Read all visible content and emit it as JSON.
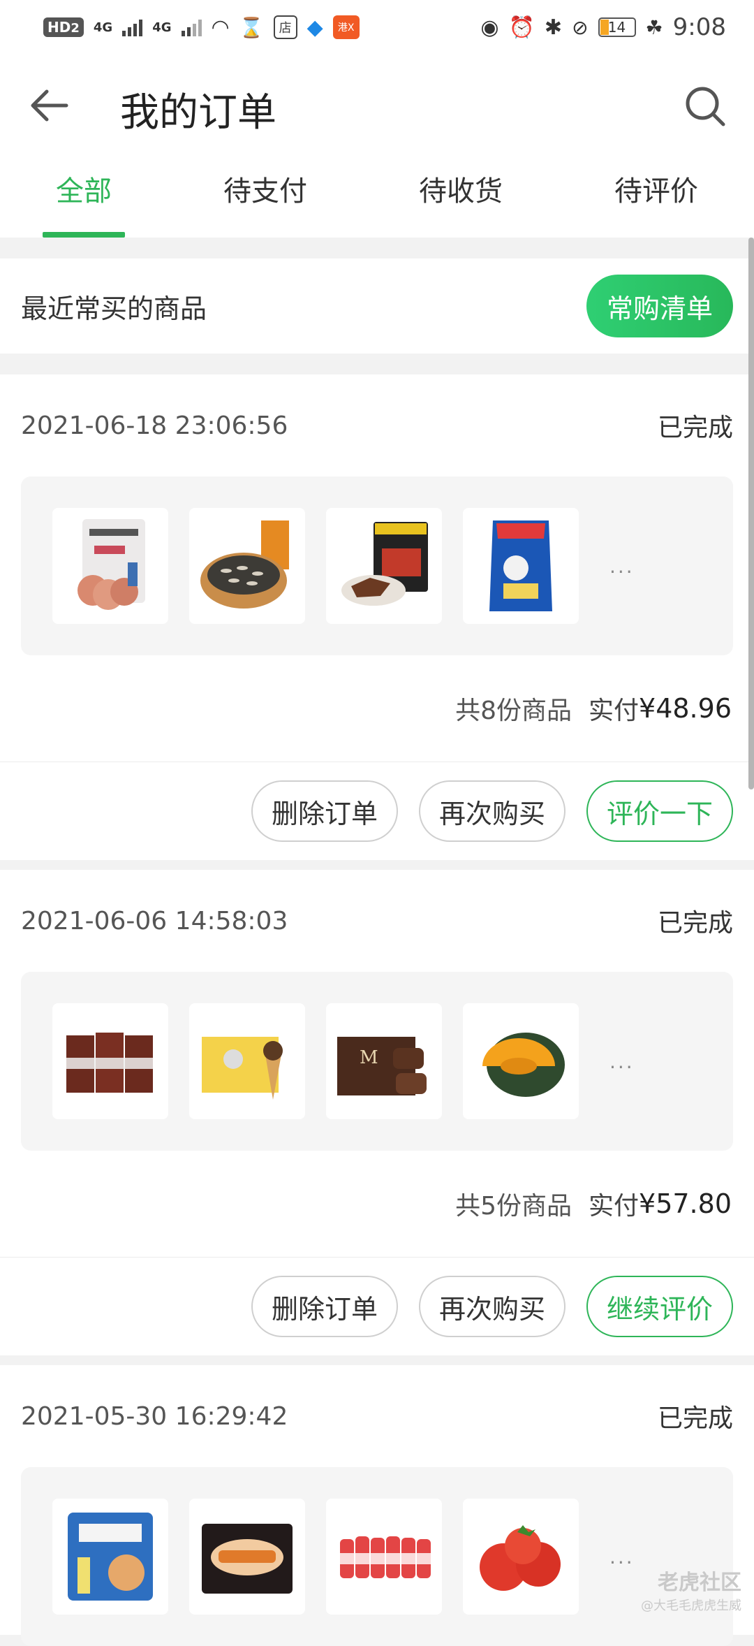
{
  "status_bar": {
    "hd": "HD",
    "hd_sub": "2",
    "net1": "4G",
    "net2": "4G",
    "store_icon": "店",
    "app_icon_text": "港X",
    "battery": "14",
    "time": "9:08"
  },
  "header": {
    "title": "我的订单"
  },
  "tabs": [
    {
      "label": "全部",
      "active": true
    },
    {
      "label": "待支付"
    },
    {
      "label": "待收货"
    },
    {
      "label": "待评价"
    }
  ],
  "frequent": {
    "title": "最近常买的商品",
    "button": "常购清单"
  },
  "orders": [
    {
      "date": "2021-06-18 23:06:56",
      "status": "已完成",
      "count_text": "共8份商品",
      "paid_label": "实付",
      "paid_amount": "¥48.96",
      "more": "...",
      "items": [
        "zianjee-ham-slices",
        "sunflower-seeds",
        "beef-jerky",
        "puffed-snack"
      ],
      "actions": [
        "删除订单",
        "再次购买",
        "评价一下"
      ]
    },
    {
      "date": "2021-06-06 14:58:03",
      "status": "已完成",
      "count_text": "共5份商品",
      "paid_label": "实付",
      "paid_amount": "¥57.80",
      "more": "...",
      "items": [
        "chocolate-milk-boxes",
        "minion-ice-cream-cones",
        "magnum-ice-cream",
        "pumpkin"
      ],
      "actions": [
        "删除订单",
        "再次购买",
        "继续评价"
      ]
    },
    {
      "date": "2021-05-30 16:29:42",
      "status": "已完成",
      "more": "...",
      "items": [
        "milk-stick-snack",
        "sanitary-pads",
        "yakult-drinks",
        "tomatoes"
      ]
    }
  ],
  "watermark": {
    "logo": "老虎社区",
    "sub": "@大毛毛虎虎生威"
  }
}
